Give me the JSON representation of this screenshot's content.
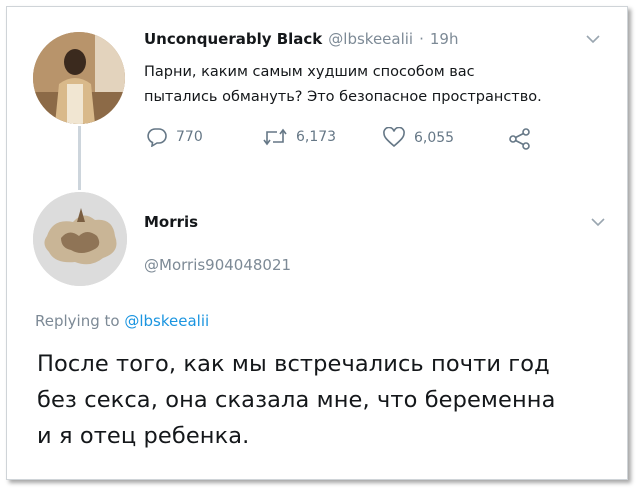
{
  "tweet": {
    "display_name": "Unconquerably Black",
    "handle": "@lbskeealii",
    "separator": "·",
    "time": "19h",
    "text_line1": "Парни, каким самым худшим способом вас",
    "text_line2": "пытались обмануть? Это безопасное пространство.",
    "actions": {
      "replies": "770",
      "retweets": "6,173",
      "likes": "6,055"
    }
  },
  "reply": {
    "display_name": "Morris",
    "handle": "@Morris904048021",
    "replying_prefix": "Replying to",
    "replying_handle": "@lbskeealii",
    "text_line1": "После того, как мы встречались почти год",
    "text_line2": "без секса, она сказала мне, что беременна",
    "text_line3": "и я отец ребенка."
  },
  "icons": [
    "reply-icon",
    "retweet-icon",
    "like-icon",
    "share-icon",
    "chevron-down-icon"
  ],
  "colors": {
    "text": "#14171a",
    "muted": "#7d8a96",
    "link": "#1b95e0",
    "thread_line": "#cdd5dc"
  }
}
